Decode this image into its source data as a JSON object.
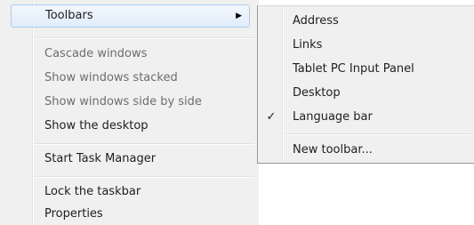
{
  "context_menu": {
    "items": [
      {
        "label": "Toolbars",
        "state": "highlighted",
        "has_submenu": true
      },
      {
        "label": "Cascade windows",
        "state": "disabled"
      },
      {
        "label": "Show windows stacked",
        "state": "disabled"
      },
      {
        "label": "Show windows side by side",
        "state": "disabled"
      },
      {
        "label": "Show the desktop",
        "state": "enabled"
      },
      {
        "label": "Start Task Manager",
        "state": "enabled"
      },
      {
        "label": "Lock the taskbar",
        "state": "enabled"
      },
      {
        "label": "Properties",
        "state": "enabled"
      }
    ],
    "submenu_arrow_icon": "chevron-right-icon"
  },
  "toolbars_submenu": {
    "items": [
      {
        "label": "Address",
        "checked": false
      },
      {
        "label": "Links",
        "checked": false
      },
      {
        "label": "Tablet PC Input Panel",
        "checked": false
      },
      {
        "label": "Desktop",
        "checked": false
      },
      {
        "label": "Language bar",
        "checked": true
      },
      {
        "label": "New toolbar...",
        "checked": false
      }
    ],
    "check_glyph": "✓"
  },
  "colors": {
    "menu_background": "#f0f0f0",
    "highlight_border": "#aaccf1",
    "highlight_fill": "#e1edfc",
    "disabled_text": "#6d6d6d"
  }
}
